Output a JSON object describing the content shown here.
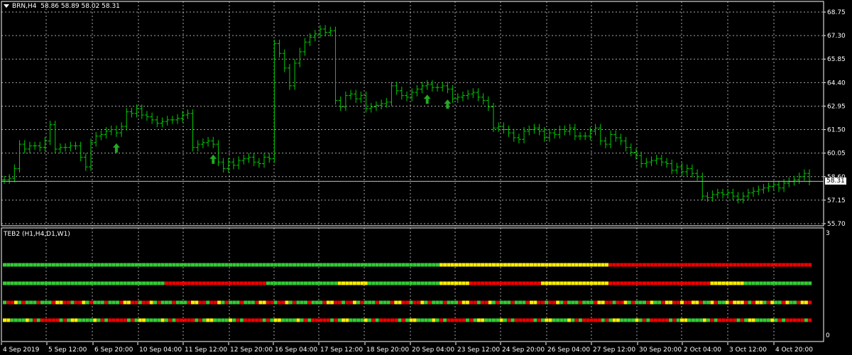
{
  "chart_header": {
    "symbol": "BRN,H4",
    "ohlc": "58.86 58.89 58.02 58.31"
  },
  "indicator_header": {
    "name": "TEB2 (H1,H4,D1,W1)"
  },
  "colors": {
    "background": "#000000",
    "candle": "#00cc00",
    "grid": "#e0e0e0",
    "up_arrow": "#22aa22",
    "down_arrow": "#dd0000",
    "green": "#33cc33",
    "yellow": "#ffee00",
    "red": "#ee0000"
  },
  "chart_data": [
    {
      "type": "line",
      "price_axis": {
        "ticks": [
          "68.75",
          "67.30",
          "65.85",
          "64.40",
          "62.95",
          "61.50",
          "60.05",
          "58.60",
          "57.15",
          "55.70"
        ],
        "ylim": [
          55.7,
          69.0
        ]
      },
      "current_price": "58.31",
      "time_axis": {
        "labels": [
          "4 Sep 2019",
          "5 Sep 12:00",
          "6 Sep 20:00",
          "10 Sep 04:00",
          "11 Sep 12:00",
          "12 Sep 20:00",
          "16 Sep 04:00",
          "17 Sep 12:00",
          "18 Sep 20:00",
          "20 Sep 04:00",
          "23 Sep 12:00",
          "24 Sep 20:00",
          "26 Sep 04:00",
          "27 Sep 12:00",
          "30 Sep 20:00",
          "2 Oct 04:00",
          "3 Oct 12:00",
          "4 Oct 20:00"
        ]
      },
      "series": [
        {
          "close": [
            58.4,
            58.5,
            59.1,
            60.6,
            60.3,
            60.5,
            60.5,
            60.4,
            60.8,
            61.8,
            60.3,
            60.4,
            60.4,
            60.5,
            60.5,
            59.8,
            59.2,
            60.7,
            61.1,
            61.2,
            61.4,
            61.5,
            61.3,
            61.7,
            62.6,
            62.5,
            62.8,
            62.4,
            62.3,
            62.1,
            61.9,
            62.0,
            62.1,
            62.1,
            62.2,
            62.4,
            62.5,
            60.4,
            60.6,
            60.7,
            60.8,
            60.6,
            59.5,
            59.1,
            59.5,
            59.3,
            59.6,
            59.7,
            59.8,
            59.5,
            59.4,
            59.8,
            59.7,
            66.8,
            66.2,
            65.3,
            64.2,
            65.6,
            66.3,
            66.9,
            67.2,
            67.4,
            67.7,
            67.5,
            67.6,
            63.3,
            62.9,
            63.6,
            63.7,
            63.4,
            63.6,
            62.8,
            62.9,
            63.0,
            63.1,
            63.2,
            64.2,
            63.9,
            63.6,
            63.5,
            63.8,
            64.0,
            64.2,
            64.3,
            64.1,
            64.1,
            64.2,
            64.0,
            63.4,
            63.5,
            63.6,
            63.7,
            63.8,
            63.5,
            63.3,
            62.9,
            61.6,
            61.7,
            61.5,
            61.3,
            61.0,
            60.9,
            61.4,
            61.5,
            61.6,
            61.4,
            61.0,
            61.3,
            61.2,
            61.5,
            61.4,
            61.6,
            61.1,
            61.1,
            61.1,
            61.4,
            61.6,
            60.8,
            60.6,
            61.2,
            61.0,
            60.8,
            60.4,
            60.1,
            59.9,
            59.4,
            59.5,
            59.6,
            59.7,
            59.5,
            59.4,
            59.0,
            59.2,
            58.9,
            59.1,
            58.8,
            58.6,
            57.4,
            57.3,
            57.5,
            57.6,
            57.5,
            57.6,
            57.4,
            57.2,
            57.4,
            57.6,
            57.7,
            57.8,
            57.9,
            58.0,
            58.1,
            57.9,
            58.2,
            58.3,
            58.4,
            58.6,
            58.8,
            58.31
          ]
        }
      ],
      "signals": [
        {
          "type": "up",
          "bar": 22
        },
        {
          "type": "up",
          "bar": 41
        },
        {
          "type": "up",
          "bar": 83
        },
        {
          "type": "up",
          "bar": 87
        },
        {
          "type": "down",
          "bar": 173
        },
        {
          "type": "down",
          "bar": 177
        }
      ]
    },
    {
      "type": "heatmap",
      "rows": [
        "H1",
        "H4",
        "D1",
        "W1"
      ],
      "ylim": [
        0,
        3
      ],
      "y_ticks": [
        "3",
        "0"
      ],
      "segments": [
        [
          [
            0,
            116,
            "green"
          ],
          [
            116,
            161,
            "yellow"
          ],
          [
            161,
            215,
            "red"
          ]
        ],
        [
          [
            0,
            43,
            "green"
          ],
          [
            43,
            70,
            "red"
          ],
          [
            70,
            89,
            "green"
          ],
          [
            89,
            97,
            "yellow"
          ],
          [
            97,
            116,
            "green"
          ],
          [
            116,
            124,
            "yellow"
          ],
          [
            124,
            143,
            "red"
          ],
          [
            143,
            161,
            "yellow"
          ],
          [
            161,
            188,
            "red"
          ],
          [
            188,
            197,
            "yellow"
          ],
          [
            197,
            215,
            "green"
          ]
        ],
        "mixed",
        "mixed"
      ]
    }
  ]
}
